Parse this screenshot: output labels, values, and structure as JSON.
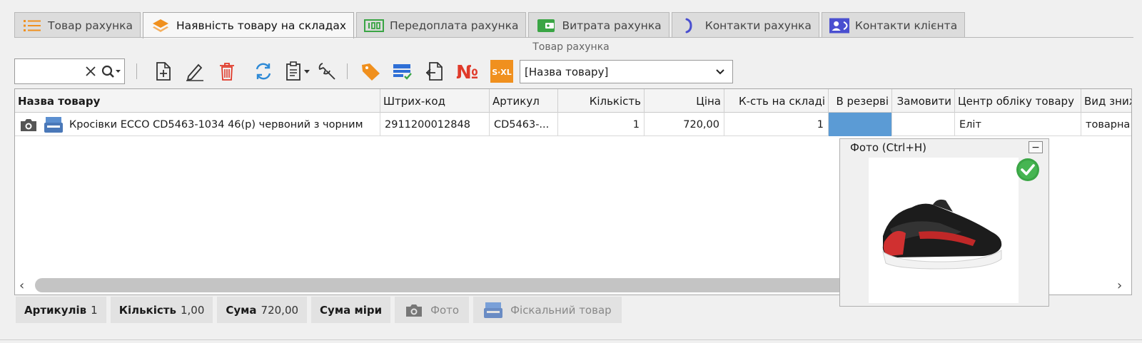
{
  "tabs": [
    {
      "label": "Товар рахунка",
      "icon": "list-icon",
      "active": false
    },
    {
      "label": "Наявність товару на складах",
      "icon": "layers-icon",
      "active": true
    },
    {
      "label": "Передоплата рахунка",
      "icon": "prepayment-icon",
      "active": false
    },
    {
      "label": "Витрата рахунка",
      "icon": "wallet-icon",
      "active": false
    },
    {
      "label": "Контакти рахунка",
      "icon": "contacts-icon",
      "active": false
    },
    {
      "label": "Контакти клієнта",
      "icon": "client-contacts-icon",
      "active": false
    }
  ],
  "section_title": "Товар рахунка",
  "search": {
    "value": ""
  },
  "combo": {
    "value": "[Назва товару]"
  },
  "colors": {
    "accent_orange": "#f0901e",
    "accent_blue": "#2e6fd6",
    "selection": "#5b9bd5",
    "red": "#e03a2a",
    "green": "#3aa545"
  },
  "grid": {
    "headers": {
      "name": "Назва товару",
      "barcode": "Штрих-код",
      "article": "Артикул",
      "qty": "Кількість",
      "price": "Ціна",
      "stock": "К-сть на складі",
      "reserve": "В резерві",
      "order": "Замовити",
      "center": "Центр обліку товару",
      "discount": "Вид зниж"
    },
    "rows": [
      {
        "name": "Кросівки ECCO CD5463-1034 46(р) червоний з чорним",
        "barcode": "2911200012848",
        "article": "CD5463-...",
        "qty": "1",
        "price": "720,00",
        "stock": "1",
        "reserve": "",
        "order": "",
        "center": "Еліт",
        "discount": "товарна"
      }
    ]
  },
  "photo": {
    "title": "Фото (Ctrl+H)",
    "min_label": "−"
  },
  "status": {
    "articles_label": "Артикулів",
    "articles_value": "1",
    "qty_label": "Кількість",
    "qty_value": "1,00",
    "sum_label": "Сума",
    "sum_value": "720,00",
    "measure_label": "Сума міри",
    "photo_btn": "Фото",
    "fiscal_btn": "Фіскальний товар"
  }
}
